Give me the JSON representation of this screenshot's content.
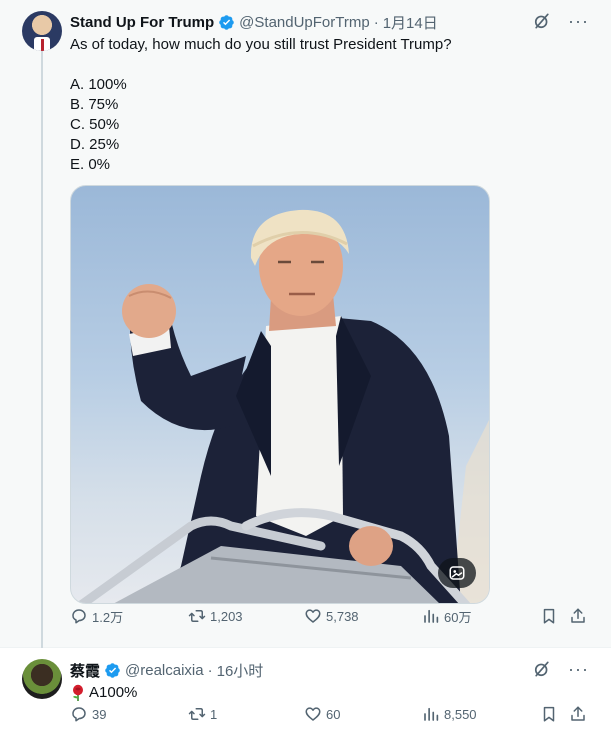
{
  "main_tweet": {
    "author": {
      "display_name": "Stand Up For Trump",
      "handle": "@StandUpForTrmp",
      "verified": true
    },
    "separator": "·",
    "timestamp": "1月14日",
    "question": "As of today, how much do you still trust President Trump?",
    "options": [
      "A. 100%",
      "B. 75%",
      "C. 50%",
      "D. 25%",
      "E. 0%"
    ],
    "media": {
      "alt_badge_icon": "image-description-icon"
    },
    "stats": {
      "replies": "1.2万",
      "retweets": "1,203",
      "likes": "5,738",
      "views": "60万"
    }
  },
  "reply_tweet": {
    "author": {
      "display_name": "蔡霞",
      "handle": "@realcaixia",
      "verified": true
    },
    "separator": "·",
    "timestamp": "16小时",
    "text": "A100%",
    "emoji_icon": "rose-icon",
    "stats": {
      "replies": "39",
      "retweets": "1",
      "likes": "60",
      "views": "8,550"
    }
  },
  "colors": {
    "verified_blue": "#1d9bf0",
    "muted_text": "#536471",
    "primary_text": "#0f1419",
    "main_bg": "#f7f9f9"
  }
}
